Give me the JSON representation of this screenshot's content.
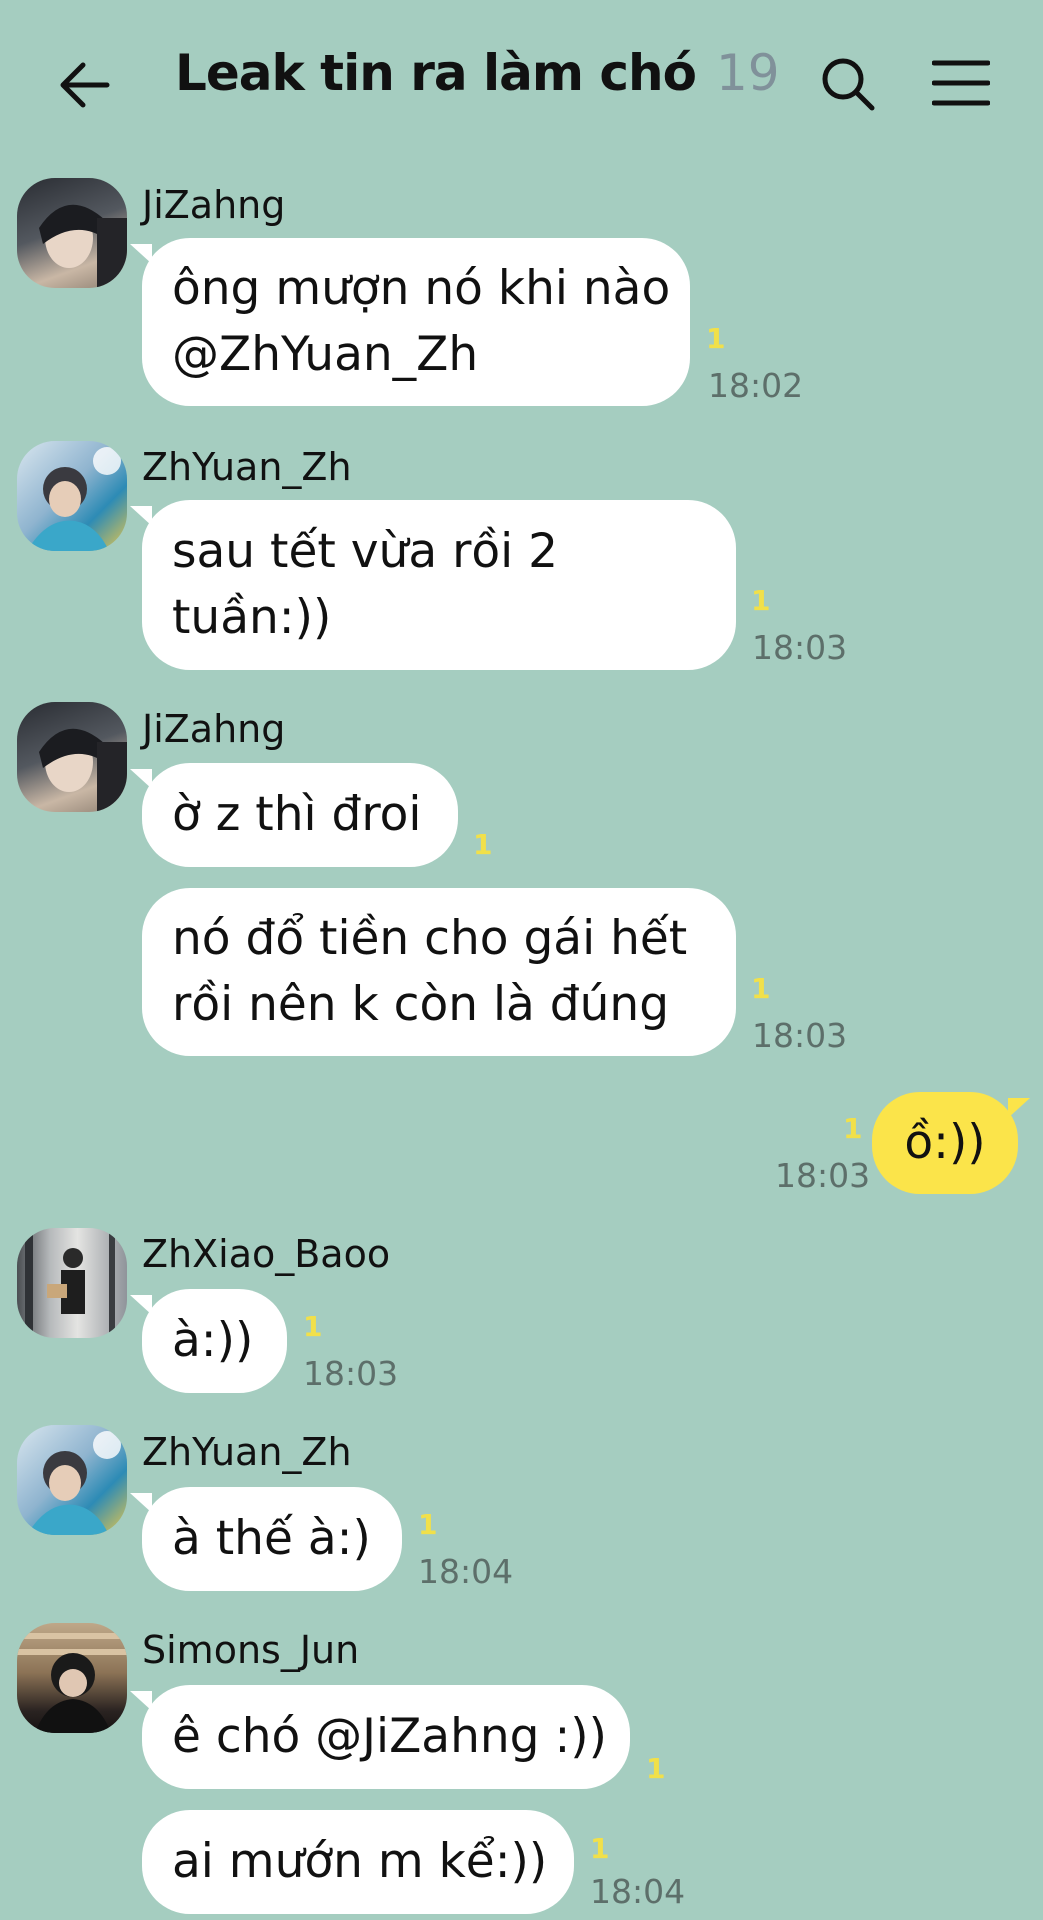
{
  "header": {
    "title": "Leak tin ra làm chó",
    "member_count": "19",
    "icons": [
      "back-arrow-icon",
      "search-icon",
      "menu-icon"
    ]
  },
  "messages": [
    {
      "sender": "JiZahng",
      "lines": [
        "ông mượn nó khi nào",
        "@ZhYuan_Zh"
      ],
      "unread": "1",
      "time": "18:02"
    },
    {
      "sender": "ZhYuan_Zh",
      "lines": [
        "sau tết vừa rồi 2",
        "tuần:))"
      ],
      "unread": "1",
      "time": "18:03"
    },
    {
      "sender": "JiZahng",
      "lines": [
        "ờ z thì đroi"
      ],
      "unread": "1",
      "time": ""
    },
    {
      "sender": "",
      "lines": [
        "nó đổ tiền cho gái hết",
        "rồi nên k còn là đúng"
      ],
      "unread": "1",
      "time": "18:03"
    },
    {
      "sender": "me",
      "lines": [
        "ồ:))"
      ],
      "unread": "1",
      "time": "18:03"
    },
    {
      "sender": "ZhXiao_Baoo",
      "lines": [
        "à:))"
      ],
      "unread": "1",
      "time": "18:03"
    },
    {
      "sender": "ZhYuan_Zh",
      "lines": [
        "à thế à:)"
      ],
      "unread": "1",
      "time": "18:04"
    },
    {
      "sender": "Simons_Jun",
      "lines": [
        "ê chó @JiZahng :))"
      ],
      "unread": "1",
      "time": ""
    },
    {
      "sender": "",
      "lines": [
        "ai mướn m kể:))"
      ],
      "unread": "1",
      "time": "18:04"
    }
  ],
  "colors": {
    "background": "#a5cdc0",
    "bubble_other": "#ffffff",
    "bubble_mine": "#fbe44a",
    "unread": "#f1e04a"
  }
}
